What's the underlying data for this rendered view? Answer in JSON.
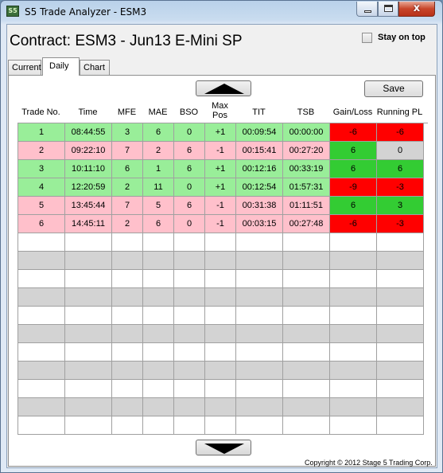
{
  "window": {
    "icon_text": "S5",
    "title": "S5 Trade Analyzer - ESM3",
    "close_glyph": "x"
  },
  "header": {
    "contract_title": "Contract: ESM3 - Jun13 E-Mini SP",
    "stay_on_top_label": "Stay on top",
    "stay_on_top_checked": false
  },
  "tabs": [
    {
      "label": "Current"
    },
    {
      "label": "Daily",
      "active": true
    },
    {
      "label": "Chart"
    }
  ],
  "toolbar": {
    "save_label": "Save"
  },
  "grid": {
    "columns": [
      "Trade No.",
      "Time",
      "MFE",
      "MAE",
      "BSO",
      "Max\nPos",
      "TIT",
      "TSB",
      "Gain/Loss",
      "Running PL"
    ],
    "rows": [
      {
        "cells": [
          "1",
          "08:44:55",
          "3",
          "6",
          "0",
          "+1",
          "00:09:54",
          "00:00:00",
          "-6",
          "-6"
        ],
        "row_color": "#99ee99",
        "gl_color": "#ff0000",
        "pl_color": "#ff0000"
      },
      {
        "cells": [
          "2",
          "09:22:10",
          "7",
          "2",
          "6",
          "-1",
          "00:15:41",
          "00:27:20",
          "6",
          "0"
        ],
        "row_color": "#ffc0cb",
        "gl_color": "#33cc33",
        "pl_color": "#d3d3d3"
      },
      {
        "cells": [
          "3",
          "10:11:10",
          "6",
          "1",
          "6",
          "+1",
          "00:12:16",
          "00:33:19",
          "6",
          "6"
        ],
        "row_color": "#99ee99",
        "gl_color": "#33cc33",
        "pl_color": "#33cc33"
      },
      {
        "cells": [
          "4",
          "12:20:59",
          "2",
          "11",
          "0",
          "+1",
          "00:12:54",
          "01:57:31",
          "-9",
          "-3"
        ],
        "row_color": "#99ee99",
        "gl_color": "#ff0000",
        "pl_color": "#ff0000"
      },
      {
        "cells": [
          "5",
          "13:45:44",
          "7",
          "5",
          "6",
          "-1",
          "00:31:38",
          "01:11:51",
          "6",
          "3"
        ],
        "row_color": "#ffc0cb",
        "gl_color": "#33cc33",
        "pl_color": "#33cc33"
      },
      {
        "cells": [
          "6",
          "14:45:11",
          "2",
          "6",
          "0",
          "-1",
          "00:03:15",
          "00:27:48",
          "-6",
          "-3"
        ],
        "row_color": "#ffc0cb",
        "gl_color": "#ff0000",
        "pl_color": "#ff0000"
      }
    ],
    "empty_row_colors": [
      "#ffffff",
      "#d3d3d3",
      "#ffffff",
      "#d3d3d3",
      "#ffffff",
      "#d3d3d3",
      "#ffffff",
      "#d3d3d3",
      "#ffffff",
      "#d3d3d3",
      "#ffffff"
    ]
  },
  "footer": {
    "copyright": "Copyright © 2012 Stage 5 Trading Corp."
  }
}
